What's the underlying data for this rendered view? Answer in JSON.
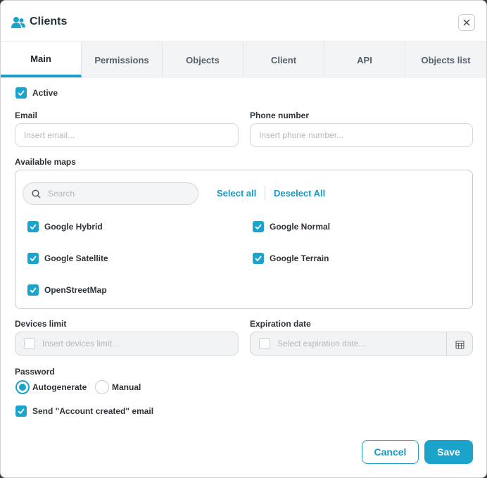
{
  "header": {
    "title": "Clients"
  },
  "tabs": [
    {
      "label": "Main"
    },
    {
      "label": "Permissions"
    },
    {
      "label": "Objects"
    },
    {
      "label": "Client"
    },
    {
      "label": "API"
    },
    {
      "label": "Objects list"
    }
  ],
  "active_tab": "Main",
  "form": {
    "active_label": "Active",
    "email_label": "Email",
    "email_placeholder": "Insert email...",
    "phone_label": "Phone number",
    "phone_placeholder": "Insert phone number...",
    "maps_label": "Available maps",
    "search_placeholder": "Search",
    "select_all": "Select all",
    "deselect_all": "Deselect All",
    "maps": [
      {
        "label": "Google Hybrid",
        "checked": true
      },
      {
        "label": "Google Normal",
        "checked": true
      },
      {
        "label": "Google Satellite",
        "checked": true
      },
      {
        "label": "Google Terrain",
        "checked": true
      },
      {
        "label": "OpenStreetMap",
        "checked": true
      }
    ],
    "devices_label": "Devices limit",
    "devices_placeholder": "Insert devices limit...",
    "expiration_label": "Expiration date",
    "expiration_placeholder": "Select expiration date...",
    "password_label": "Password",
    "password_options": [
      {
        "label": "Autogenerate",
        "selected": true
      },
      {
        "label": "Manual",
        "selected": false
      }
    ],
    "send_email_label": "Send \"Account created\" email"
  },
  "footer": {
    "cancel": "Cancel",
    "save": "Save"
  },
  "colors": {
    "accent": "#1aa3cb",
    "border": "#c9ced3",
    "text": "#2e3338"
  }
}
